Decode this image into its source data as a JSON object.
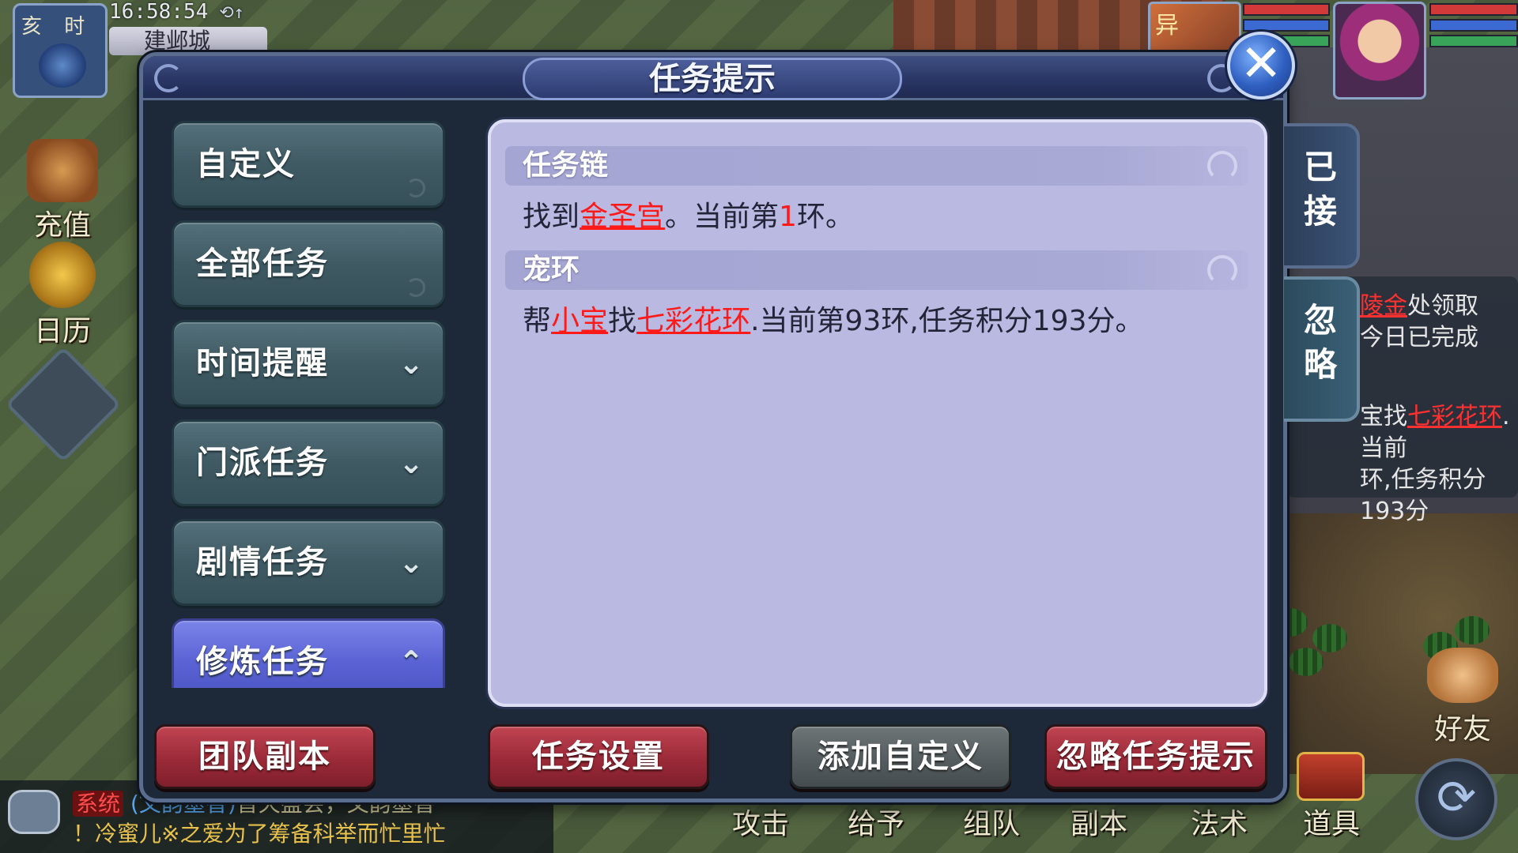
{
  "hud": {
    "period": "亥 时",
    "clock": "16:58:54",
    "city": "建邺城",
    "recharge_label": "充值",
    "calendar_label": "日历",
    "pet_badge": "异"
  },
  "dialog": {
    "title": "任务提示",
    "close_label": "✕"
  },
  "nav": {
    "items": [
      {
        "label": "自定义",
        "chevron": ""
      },
      {
        "label": "全部任务",
        "chevron": ""
      },
      {
        "label": "时间提醒",
        "chevron": "⌄"
      },
      {
        "label": "门派任务",
        "chevron": "⌄"
      },
      {
        "label": "剧情任务",
        "chevron": "⌄"
      },
      {
        "label": "修炼任务",
        "chevron": "⌃"
      }
    ]
  },
  "tasks": [
    {
      "title": "任务链",
      "pre": "找到",
      "target": "金圣宫",
      "mid": "。当前第",
      "ring": "1",
      "post": "环。"
    },
    {
      "title": "宠环",
      "pre": "帮",
      "npc": "小宝",
      "mid": "找",
      "item": "七彩花环",
      "post": ".当前第93环,任务积分193分。"
    }
  ],
  "side_tabs": {
    "accepted": "已接",
    "ignore": "忽略"
  },
  "actions": {
    "team_dungeon": "团队副本",
    "task_settings": "任务设置",
    "add_custom": "添加自定义",
    "ignore_tips": "忽略任务提示"
  },
  "tracker": {
    "line1_red": "陵金",
    "line1_rest": "处领取",
    "line2": "今日已完成",
    "line3_pre": "宝找",
    "line3_red": "七彩花环",
    "line3_rest": ".当前",
    "line4": "环,任务积分193分"
  },
  "chat": {
    "tag": "系统",
    "name": "(文韵墨香)",
    "line1_rest": "普天盛会，文韵墨香",
    "line2": "！冷蜜儿※之爱为了筹备科举而忙里忙"
  },
  "bottom_bar": {
    "attack": "攻击",
    "give": "给予",
    "team": "组队",
    "dungeon": "副本",
    "magic": "法术",
    "items": "道具",
    "friends": "好友"
  },
  "colors": {
    "dialog_bg": "#1d2838",
    "panel_bg": "#b9b9e2",
    "nav_teal": "#3f5a63",
    "nav_active": "#5a63d4",
    "btn_red": "#9b2a38",
    "btn_gray": "#555d60",
    "highlight_red": "#ff1a1a"
  }
}
